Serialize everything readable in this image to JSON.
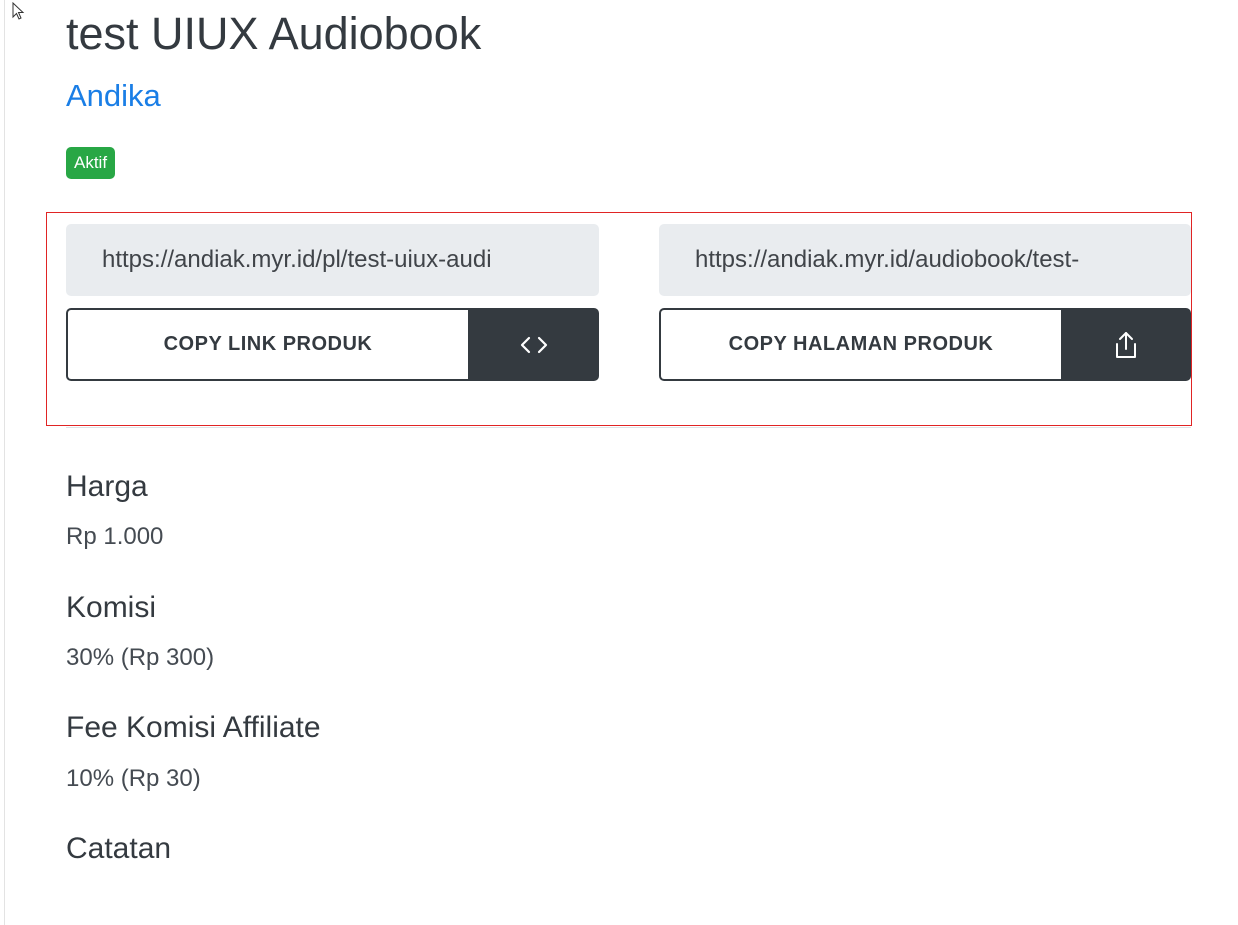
{
  "product": {
    "title": "test UIUX Audiobook",
    "author": "Andika",
    "status_badge": "Aktif"
  },
  "links": {
    "product_link_value": "https://andiak.myr.id/pl/test-uiux-audi",
    "copy_product_link_label": "COPY LINK PRODUK",
    "page_link_value": "https://andiak.myr.id/audiobook/test-",
    "copy_page_link_label": "COPY HALAMAN PRODUK",
    "embed_icon": "code-icon",
    "share_icon": "share-icon"
  },
  "details": {
    "price_label": "Harga",
    "price_value": "Rp 1.000",
    "commission_label": "Komisi",
    "commission_value": "30% (Rp 300)",
    "affiliate_fee_label": "Fee Komisi Affiliate",
    "affiliate_fee_value": "10% (Rp 30)",
    "notes_label": "Catatan"
  },
  "colors": {
    "author_link": "#1a7ee6",
    "badge_active": "#28a745",
    "button_dark": "#343a40",
    "highlight_border": "#e02424",
    "input_background": "#e9ecef"
  }
}
